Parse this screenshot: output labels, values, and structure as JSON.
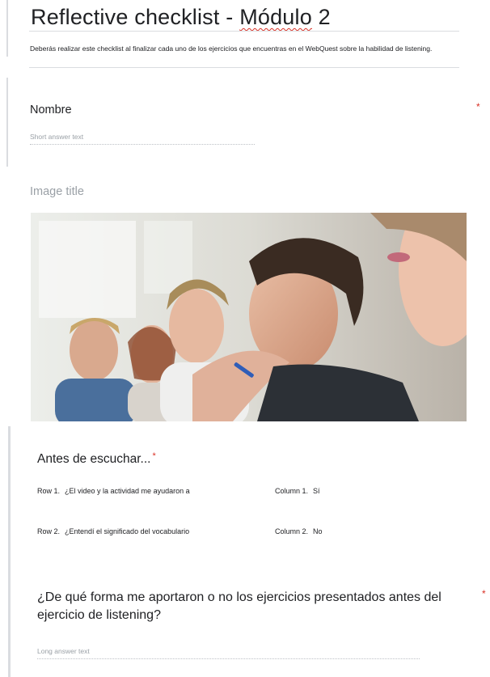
{
  "form": {
    "title_prefix": "Reflective checklist - ",
    "title_highlight": "Módulo",
    "title_suffix": " 2",
    "description": "Deberás realizar este checklist al finalizar cada uno de los ejercicios que encuentras en el WebQuest sobre la habilidad de listening."
  },
  "questions": {
    "nombre": {
      "title": "Nombre",
      "required_mark": "*",
      "answer_placeholder": "Short answer text"
    },
    "image": {
      "title": "Image title"
    },
    "grid": {
      "title": "Antes de escuchar...",
      "required_mark": "*",
      "rows": [
        {
          "label": "Row 1.",
          "text": "¿El video y la actividad me ayudaron a"
        },
        {
          "label": "Row 2.",
          "text": "¿Entendí el significado del vocabulario"
        }
      ],
      "columns": [
        {
          "label": "Column 1.",
          "text": "Sí"
        },
        {
          "label": "Column 2.",
          "text": "No"
        }
      ]
    },
    "long": {
      "title": "¿De qué forma me aportaron o no los ejercicios presentados antes del ejercicio de listening?",
      "required_mark": "*",
      "answer_placeholder": "Long answer text"
    }
  },
  "colors": {
    "required": "#d93025",
    "placeholder": "#9aa0a6",
    "text": "#202124",
    "divider": "#dadce0"
  }
}
